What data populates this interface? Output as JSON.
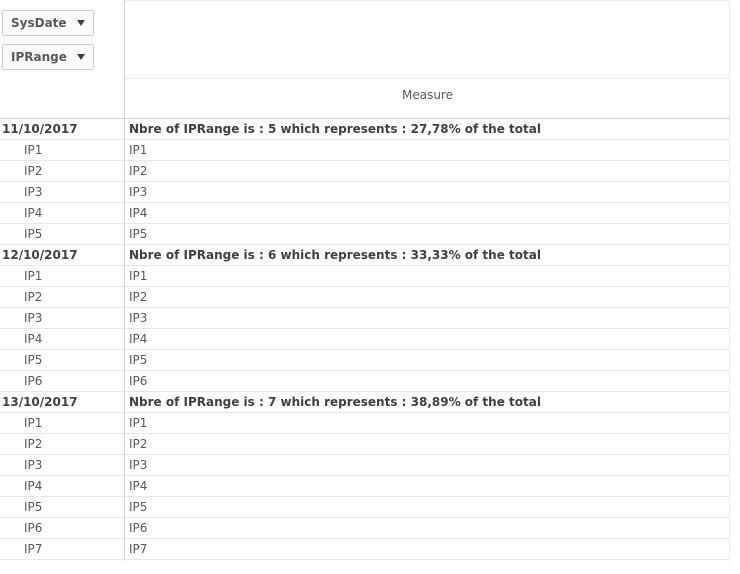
{
  "dimensions": {
    "sysdate_label": "SysDate",
    "iprange_label": "IPRange"
  },
  "table": {
    "measure_header": "Measure",
    "groups": [
      {
        "date": "11/10/2017",
        "summary": "Nbre of IPRange is : 5 which represents : 27,78% of the total",
        "items": [
          "IP1",
          "IP2",
          "IP3",
          "IP4",
          "IP5"
        ]
      },
      {
        "date": "12/10/2017",
        "summary": "Nbre of IPRange is : 6 which represents : 33,33% of the total",
        "items": [
          "IP1",
          "IP2",
          "IP3",
          "IP4",
          "IP5",
          "IP6"
        ]
      },
      {
        "date": "13/10/2017",
        "summary": "Nbre of IPRange is : 7 which represents : 38,89% of the total",
        "items": [
          "IP1",
          "IP2",
          "IP3",
          "IP4",
          "IP5",
          "IP6",
          "IP7"
        ]
      }
    ]
  }
}
